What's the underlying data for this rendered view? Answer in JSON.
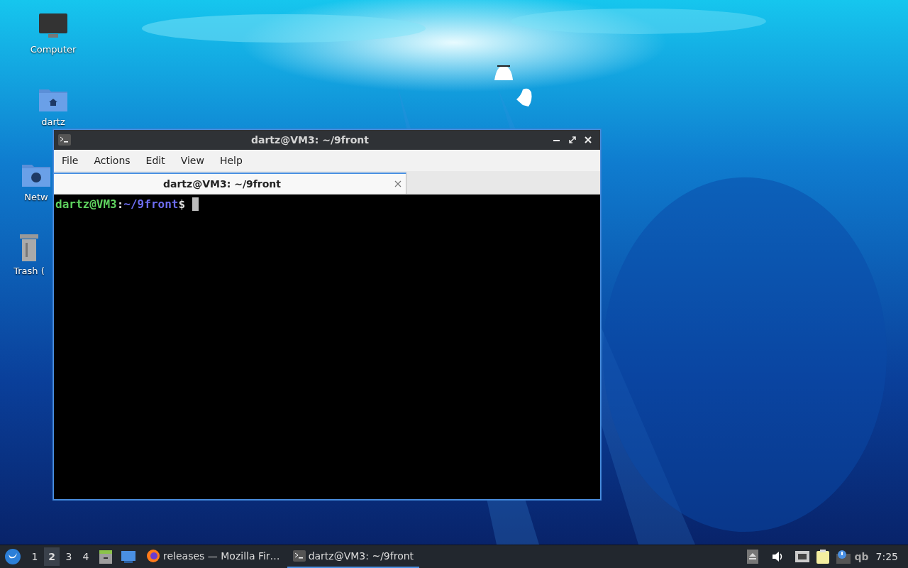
{
  "desktop_icons": [
    {
      "label": "Computer",
      "kind": "computer"
    },
    {
      "label": "dartz",
      "kind": "home"
    },
    {
      "label": "Netw",
      "kind": "network"
    },
    {
      "label": "Trash (",
      "kind": "trash"
    }
  ],
  "terminal": {
    "title": "dartz@VM3: ~/9front",
    "menu": [
      "File",
      "Actions",
      "Edit",
      "View",
      "Help"
    ],
    "tabs": [
      {
        "label": "dartz@VM3: ~/9front",
        "selected": true
      }
    ],
    "prompt": [
      {
        "text": "dartz@VM3",
        "kind": "user"
      },
      {
        "text": ":",
        "kind": "plain"
      },
      {
        "text": "~/9front",
        "kind": "path"
      },
      {
        "text": "$",
        "kind": "plain"
      }
    ]
  },
  "taskbar": {
    "workspaces": [
      {
        "label": "1",
        "selected": false
      },
      {
        "label": "2",
        "selected": true
      },
      {
        "label": "3",
        "selected": false
      },
      {
        "label": "4",
        "selected": false
      }
    ],
    "tasks": [
      {
        "label": "releases — Mozilla Fir…",
        "kind": "browser",
        "selected": false
      },
      {
        "label": "dartz@VM3: ~/9front",
        "kind": "terminal",
        "selected": true
      }
    ],
    "tray_text": "qb",
    "clock": "7:25"
  }
}
